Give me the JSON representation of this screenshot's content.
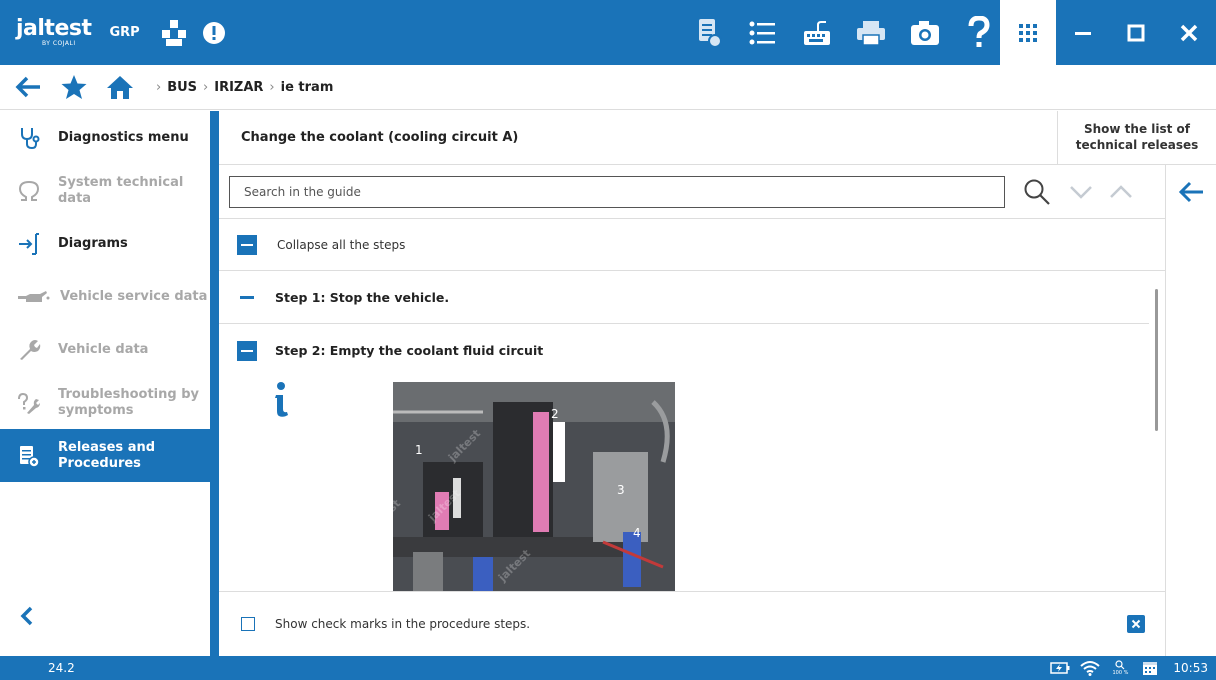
{
  "app": {
    "brand": "jaltest",
    "brand_sub": "BY COJALI",
    "group": "GRP"
  },
  "icons": {
    "top_left": [
      "tree-icon",
      "alert-icon"
    ],
    "toolbar": [
      "report-icon",
      "list-icon",
      "keyboard-icon",
      "printer-icon",
      "camera-icon",
      "help-icon"
    ],
    "window": [
      "apps-grid-icon",
      "minimize-icon",
      "maximize-icon",
      "close-icon"
    ]
  },
  "breadcrumb": {
    "items": [
      "BUS",
      "IRIZAR",
      "ie tram"
    ]
  },
  "sidebar": {
    "items": [
      {
        "label": "Diagnostics menu",
        "state": "enabled"
      },
      {
        "label": "System technical data",
        "state": "disabled"
      },
      {
        "label": "Diagrams",
        "state": "enabled"
      },
      {
        "label": "Vehicle service data",
        "state": "disabled"
      },
      {
        "label": "Vehicle data",
        "state": "disabled"
      },
      {
        "label": "Troubleshooting by symptoms",
        "state": "disabled"
      },
      {
        "label": "Releases and Procedures",
        "state": "active"
      }
    ]
  },
  "procedure": {
    "title": "Change the coolant (cooling circuit A)",
    "releases_link": "Show the list of technical releases",
    "search_placeholder": "Search in the guide",
    "collapse_label": "Collapse all the steps",
    "steps": [
      {
        "label": "Step 1: Stop the vehicle.",
        "expanded": false
      },
      {
        "label": "Step 2: Empty the coolant fluid circuit",
        "expanded": true
      }
    ],
    "photo_labels": [
      "1",
      "2",
      "3",
      "4"
    ],
    "watermark": "jaltest",
    "check_marks_label": "Show check marks in the procedure steps."
  },
  "status": {
    "version": "24.2",
    "zoom": "100 %",
    "time": "10:53"
  },
  "colors": {
    "accent": "#1a73b8",
    "disabled_text": "#a8a8a8",
    "photo_pink": "#e07cb4"
  }
}
